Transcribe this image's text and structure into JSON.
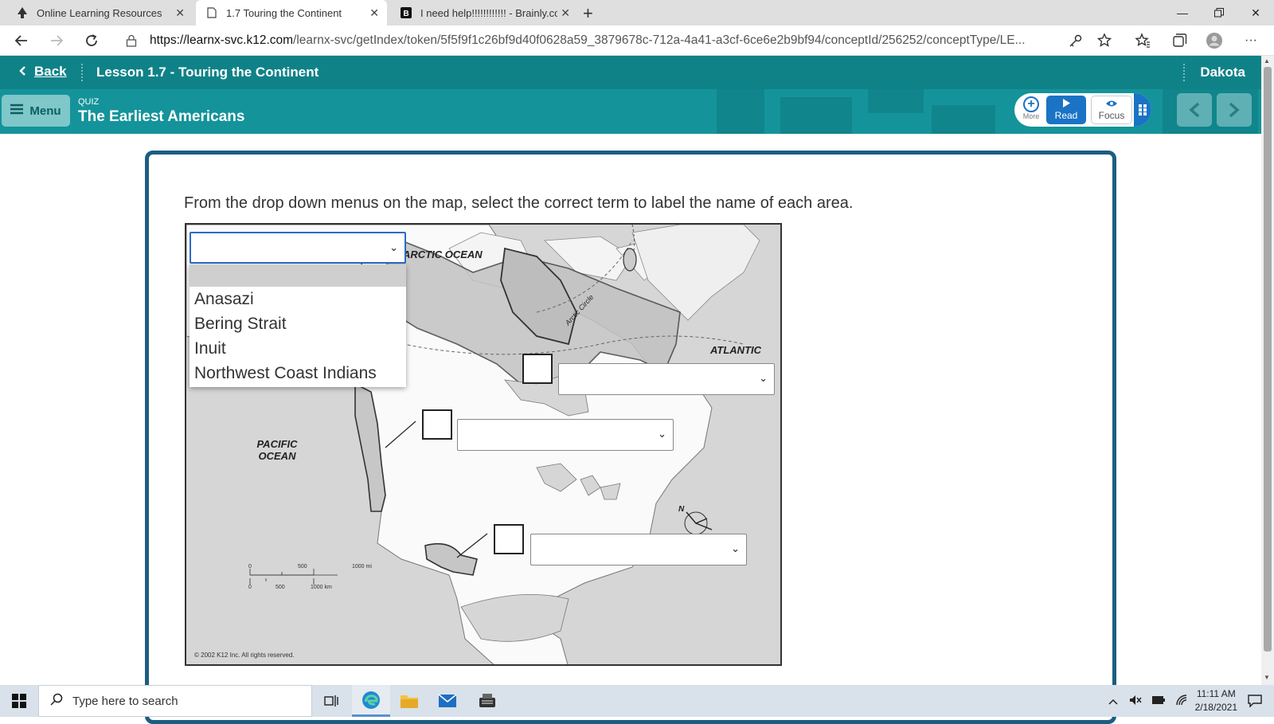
{
  "browser": {
    "tabs": [
      {
        "title": "Online Learning Resources",
        "active": false
      },
      {
        "title": "1.7 Touring the Continent",
        "active": true
      },
      {
        "title": "I need help!!!!!!!!!!!! - Brainly.com",
        "active": false
      }
    ],
    "url_host": "https://learnx-svc.k12.com",
    "url_path": "/learnx-svc/getIndex/token/5f5f9f1c26bf9d40f0628a59_3879678c-712a-4a41-a3cf-6ce6e2b9bf94/conceptId/256252/conceptType/LE..."
  },
  "header": {
    "back_label": "Back",
    "lesson_title": "Lesson 1.7 - Touring the Continent",
    "user_name": "Dakota",
    "menu_label": "Menu",
    "quiz_label": "QUIZ",
    "quiz_title": "The Earliest Americans",
    "tools": {
      "more": "More",
      "read": "Read",
      "focus": "Focus"
    }
  },
  "question": {
    "instructions": "From the drop down menus on the map, select the correct term to label the name of each area.",
    "map_labels": {
      "arctic": "ARCTIC OCEAN",
      "pacific": "PACIFIC OCEAN",
      "atlantic": "ATLANTIC OCEAN",
      "arctic_circle": "Arctic Circle",
      "north": "N"
    },
    "scale": {
      "mi_0": "0",
      "mi_500": "500",
      "mi_1000": "1000 mi",
      "km_0": "0",
      "km_500": "500",
      "km_1000": "1000 km"
    },
    "copyright": "© 2002 K12 Inc. All rights reserved.",
    "dropdown_options": [
      "Anasazi",
      "Bering Strait",
      "Inuit",
      "Northwest Coast Indians"
    ],
    "selects": [
      {
        "value": "",
        "state": "open"
      },
      {
        "value": "",
        "state": "closed"
      },
      {
        "value": "",
        "state": "closed"
      },
      {
        "value": "",
        "state": "closed"
      }
    ]
  },
  "taskbar": {
    "search_placeholder": "Type here to search",
    "time": "11:11 AM",
    "date": "2/18/2021"
  },
  "colors": {
    "header_dark": "#0f8288",
    "header_light": "#14939a",
    "card_border": "#1c5d82",
    "accent_blue": "#1a73c4"
  }
}
